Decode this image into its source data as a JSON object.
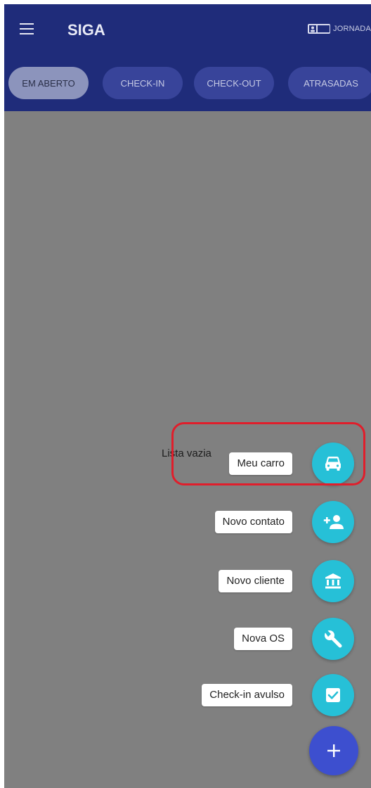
{
  "app": {
    "title": "SIGA",
    "jornada_label": "JORNADA"
  },
  "tabs": [
    {
      "label": "EM ABERTO",
      "active": true
    },
    {
      "label": "CHECK-IN",
      "active": false
    },
    {
      "label": "CHECK-OUT",
      "active": false
    },
    {
      "label": "ATRASADAS",
      "active": false
    }
  ],
  "empty_state": "Lista vazia",
  "speed_dial": [
    {
      "label": "Meu carro",
      "icon": "car-icon"
    },
    {
      "label": "Novo contato",
      "icon": "add-person-icon"
    },
    {
      "label": "Novo cliente",
      "icon": "bank-icon"
    },
    {
      "label": "Nova OS",
      "icon": "wrench-icon"
    },
    {
      "label": "Check-in avulso",
      "icon": "checkbox-icon"
    }
  ],
  "main_fab": {
    "icon": "plus-icon"
  },
  "colors": {
    "appbar": "#1f2c7a",
    "overlay_background": "#808080",
    "mini_fab": "#26c0d7",
    "main_fab": "#3d4fcf",
    "highlight_border": "#e01e2b"
  }
}
